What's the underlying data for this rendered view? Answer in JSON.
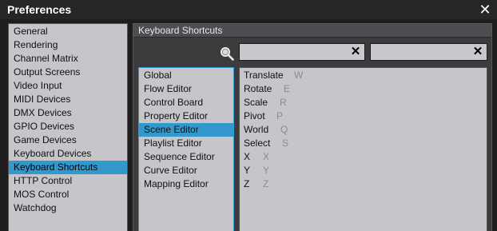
{
  "window": {
    "title": "Preferences"
  },
  "categories": [
    "General",
    "Rendering",
    "Channel Matrix",
    "Output Screens",
    "Video Input",
    "MIDI Devices",
    "DMX Devices",
    "GPIO Devices",
    "Game Devices",
    "Keyboard Devices",
    "Keyboard Shortcuts",
    "HTTP Control",
    "MOS Control",
    "Watchdog"
  ],
  "selected_category": "Keyboard Shortcuts",
  "panel": {
    "header": "Keyboard Shortcuts"
  },
  "search": {
    "field1_value": "",
    "field2_value": ""
  },
  "groups": [
    "Global",
    "Flow Editor",
    "Control Board",
    "Property Editor",
    "Scene Editor",
    "Playlist Editor",
    "Sequence Editor",
    "Curve Editor",
    "Mapping Editor"
  ],
  "selected_group": "Scene Editor",
  "shortcuts": [
    {
      "name": "Translate",
      "key": "W"
    },
    {
      "name": "Rotate",
      "key": "E"
    },
    {
      "name": "Scale",
      "key": "R"
    },
    {
      "name": "Pivot",
      "key": "P"
    },
    {
      "name": "World",
      "key": "Q"
    },
    {
      "name": "Select",
      "key": "S"
    },
    {
      "name": "X",
      "key": "X"
    },
    {
      "name": "Y",
      "key": "Y"
    },
    {
      "name": "Z",
      "key": "Z"
    }
  ],
  "colors": {
    "selection": "#3399cc",
    "list_bg": "#c5c6ca",
    "panel_bg": "#3c3c3e",
    "titlebar": "#262626"
  },
  "icons": {
    "close": "close-icon",
    "search": "search-icon",
    "clear": "clear-icon"
  }
}
